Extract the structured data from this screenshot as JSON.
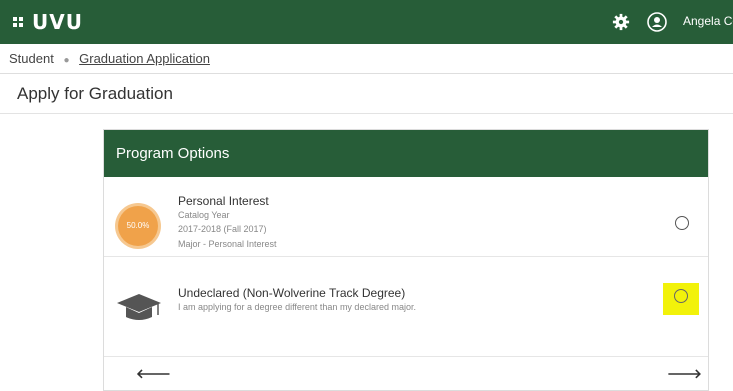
{
  "header": {
    "logo": "UVU",
    "user_name": "Angela Co"
  },
  "breadcrumb": {
    "items": [
      "Student",
      "Graduation Application"
    ]
  },
  "page": {
    "title": "Apply for Graduation"
  },
  "card": {
    "title": "Program Options",
    "options": [
      {
        "progress_label": "50.0%",
        "progress_fraction": 0.5,
        "title": "Personal Interest",
        "lines": [
          "Catalog Year",
          "2017-2018 (Fall 2017)",
          "Major - Personal Interest"
        ]
      },
      {
        "title": "Undeclared (Non-Wolverine Track Degree)",
        "lines": [
          "I am applying for a degree different than my declared major."
        ]
      }
    ],
    "nav": {
      "prev": "🡐",
      "next": "🡒"
    }
  },
  "colors": {
    "brand_green": "#275d38",
    "progress_orange": "#f0a24a",
    "highlight_yellow": "#f2f20a"
  },
  "icons": [
    "grid-icon",
    "gear-icon",
    "user-icon",
    "graduation-cap-icon",
    "arrow-left-icon",
    "arrow-right-icon"
  ]
}
